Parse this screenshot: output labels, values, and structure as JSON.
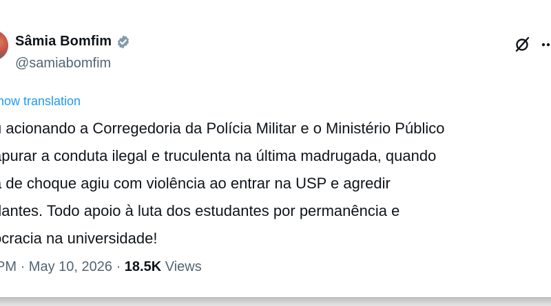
{
  "author": {
    "name": "Sâmia Bomfim",
    "handle": "@samiabomfim"
  },
  "post": {
    "translate_link": "how translation",
    "text_lines": [
      "u acionando a Corregedoria da Polícia Militar e o Ministério Público",
      "apurar a conduta ilegal e truculenta na última madrugada, quando",
      "a de choque agiu com violência ao entrar na USP e agredir",
      "dantes. Todo apoio à luta dos estudantes por permanência e",
      "ocracia na universidade!"
    ],
    "time": "PM",
    "separator1": "·",
    "date": "May 10, 2026",
    "separator2": "·",
    "views_count": "18.5K",
    "views_label": "Views"
  },
  "icons": {
    "verified": "verified-badge-icon",
    "grok": "grok-icon",
    "more": "more-icon"
  },
  "colors": {
    "link": "#1d9bf0",
    "text": "#0f1419",
    "secondary": "#536471",
    "badge": "#829aab"
  }
}
